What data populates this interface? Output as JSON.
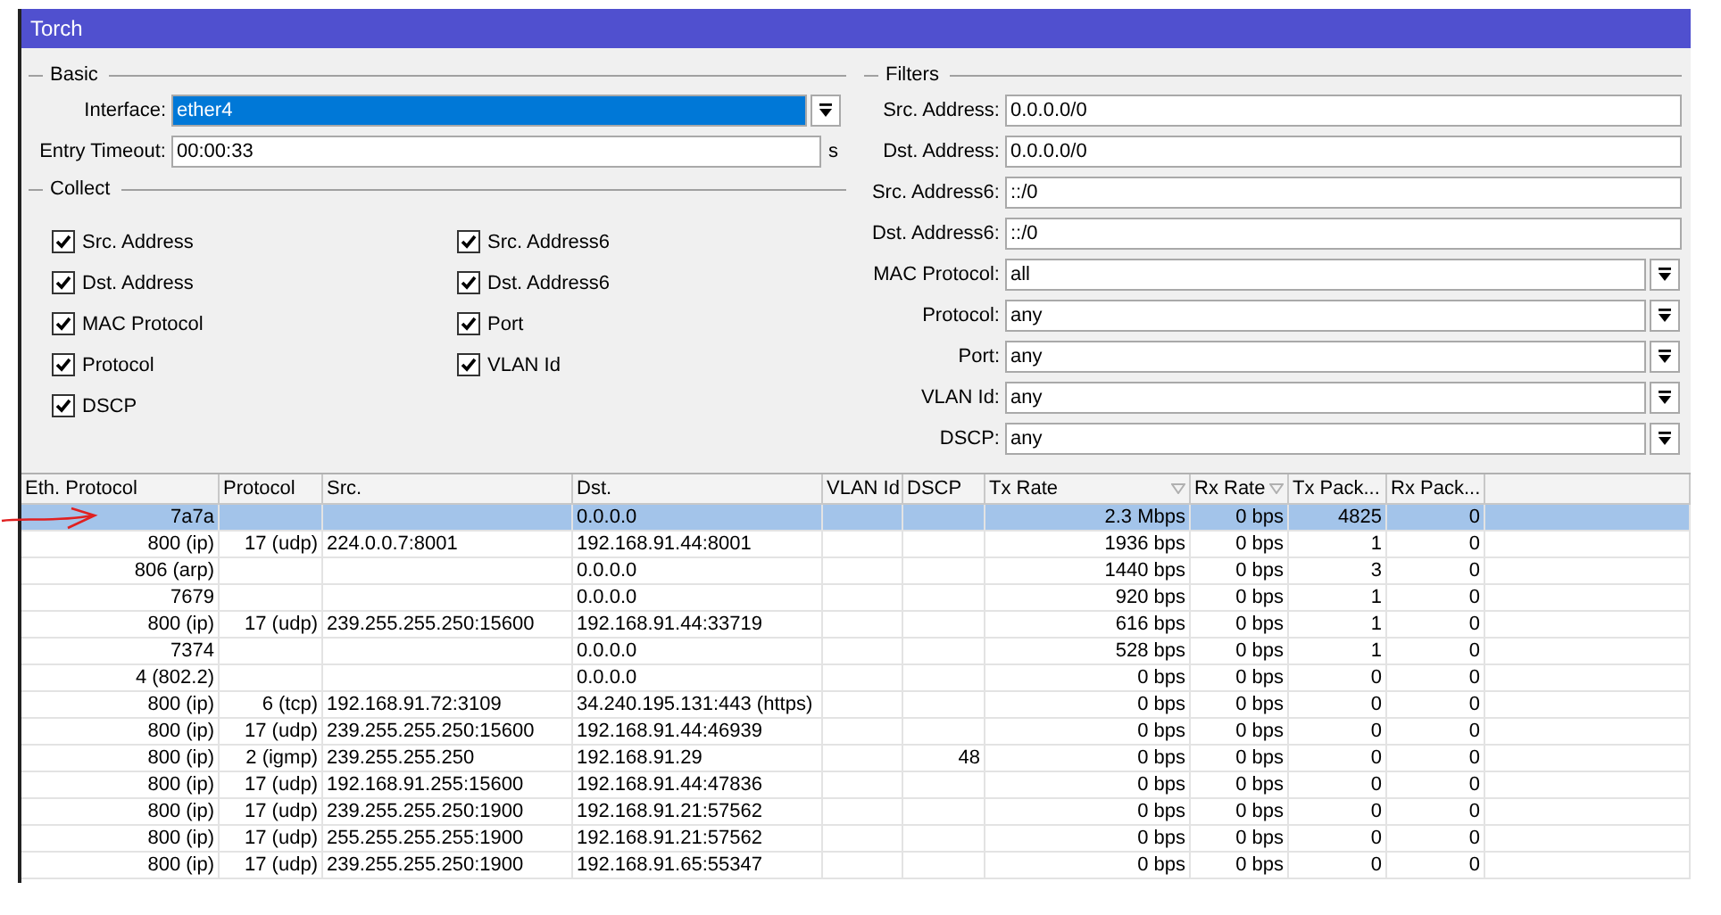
{
  "window": {
    "title": "Torch"
  },
  "basic": {
    "title": "Basic",
    "fields": [
      {
        "label": "Interface:",
        "value": "ether4",
        "kind": "dropdown",
        "selected": true
      },
      {
        "label": "Entry Timeout:",
        "value": "00:00:33",
        "kind": "text",
        "selected": false,
        "unit": "s"
      }
    ]
  },
  "collect": {
    "title": "Collect",
    "options": [
      {
        "label": "Src. Address",
        "checked": true
      },
      {
        "label": "Src. Address6",
        "checked": true
      },
      {
        "label": "Dst. Address",
        "checked": true
      },
      {
        "label": "Dst. Address6",
        "checked": true
      },
      {
        "label": "MAC Protocol",
        "checked": true
      },
      {
        "label": "Port",
        "checked": true
      },
      {
        "label": "Protocol",
        "checked": true
      },
      {
        "label": "VLAN Id",
        "checked": true
      },
      {
        "label": "DSCP",
        "checked": true
      }
    ]
  },
  "filters": {
    "title": "Filters",
    "fields": [
      {
        "label": "Src. Address:",
        "value": "0.0.0.0/0",
        "kind": "text"
      },
      {
        "label": "Dst. Address:",
        "value": "0.0.0.0/0",
        "kind": "text"
      },
      {
        "label": "Src. Address6:",
        "value": "::/0",
        "kind": "text"
      },
      {
        "label": "Dst. Address6:",
        "value": "::/0",
        "kind": "text"
      },
      {
        "label": "MAC Protocol:",
        "value": "all",
        "kind": "dropdown"
      },
      {
        "label": "Protocol:",
        "value": "any",
        "kind": "dropdown"
      },
      {
        "label": "Port:",
        "value": "any",
        "kind": "dropdown"
      },
      {
        "label": "VLAN Id:",
        "value": "any",
        "kind": "dropdown"
      },
      {
        "label": "DSCP:",
        "value": "any",
        "kind": "dropdown"
      }
    ]
  },
  "table": {
    "columns": [
      {
        "label": "Eth. Protocol",
        "sort_indicator": false
      },
      {
        "label": "Protocol",
        "sort_indicator": false
      },
      {
        "label": "Src.",
        "sort_indicator": false
      },
      {
        "label": "Dst.",
        "sort_indicator": false
      },
      {
        "label": "VLAN Id",
        "sort_indicator": false
      },
      {
        "label": "DSCP",
        "sort_indicator": false
      },
      {
        "label": "Tx Rate",
        "sort_indicator": true
      },
      {
        "label": "Rx Rate",
        "sort_indicator": true
      },
      {
        "label": "Tx Pack...",
        "sort_indicator": false
      },
      {
        "label": "Rx Pack...",
        "sort_indicator": false
      }
    ],
    "rows": [
      {
        "selected": true,
        "cells": [
          "7a7a",
          null,
          null,
          "0.0.0.0",
          null,
          null,
          "2.3 Mbps",
          "0 bps",
          "4825",
          "0"
        ]
      },
      {
        "selected": false,
        "cells": [
          "800 (ip)",
          "17 (udp)",
          "224.0.0.7:8001",
          "192.168.91.44:8001",
          null,
          null,
          "1936 bps",
          "0 bps",
          "1",
          "0"
        ]
      },
      {
        "selected": false,
        "cells": [
          "806 (arp)",
          null,
          null,
          "0.0.0.0",
          null,
          null,
          "1440 bps",
          "0 bps",
          "3",
          "0"
        ]
      },
      {
        "selected": false,
        "cells": [
          "7679",
          null,
          null,
          "0.0.0.0",
          null,
          null,
          "920 bps",
          "0 bps",
          "1",
          "0"
        ]
      },
      {
        "selected": false,
        "cells": [
          "800 (ip)",
          "17 (udp)",
          "239.255.255.250:15600",
          "192.168.91.44:33719",
          null,
          null,
          "616 bps",
          "0 bps",
          "1",
          "0"
        ]
      },
      {
        "selected": false,
        "cells": [
          "7374",
          null,
          null,
          "0.0.0.0",
          null,
          null,
          "528 bps",
          "0 bps",
          "1",
          "0"
        ]
      },
      {
        "selected": false,
        "cells": [
          "4 (802.2)",
          null,
          null,
          "0.0.0.0",
          null,
          null,
          "0 bps",
          "0 bps",
          "0",
          "0"
        ]
      },
      {
        "selected": false,
        "cells": [
          "800 (ip)",
          "6 (tcp)",
          "192.168.91.72:3109",
          "34.240.195.131:443 (https)",
          null,
          null,
          "0 bps",
          "0 bps",
          "0",
          "0"
        ]
      },
      {
        "selected": false,
        "cells": [
          "800 (ip)",
          "17 (udp)",
          "239.255.255.250:15600",
          "192.168.91.44:46939",
          null,
          null,
          "0 bps",
          "0 bps",
          "0",
          "0"
        ]
      },
      {
        "selected": false,
        "cells": [
          "800 (ip)",
          "2 (igmp)",
          "239.255.255.250",
          "192.168.91.29",
          null,
          "48",
          "0 bps",
          "0 bps",
          "0",
          "0"
        ]
      },
      {
        "selected": false,
        "cells": [
          "800 (ip)",
          "17 (udp)",
          "192.168.91.255:15600",
          "192.168.91.44:47836",
          null,
          null,
          "0 bps",
          "0 bps",
          "0",
          "0"
        ]
      },
      {
        "selected": false,
        "cells": [
          "800 (ip)",
          "17 (udp)",
          "239.255.255.250:1900",
          "192.168.91.21:57562",
          null,
          null,
          "0 bps",
          "0 bps",
          "0",
          "0"
        ]
      },
      {
        "selected": false,
        "cells": [
          "800 (ip)",
          "17 (udp)",
          "255.255.255.255:1900",
          "192.168.91.21:57562",
          null,
          null,
          "0 bps",
          "0 bps",
          "0",
          "0"
        ]
      },
      {
        "selected": false,
        "cells": [
          "800 (ip)",
          "17 (udp)",
          "239.255.255.250:1900",
          "192.168.91.65:55347",
          null,
          null,
          "0 bps",
          "0 bps",
          "0",
          "0"
        ]
      }
    ]
  }
}
